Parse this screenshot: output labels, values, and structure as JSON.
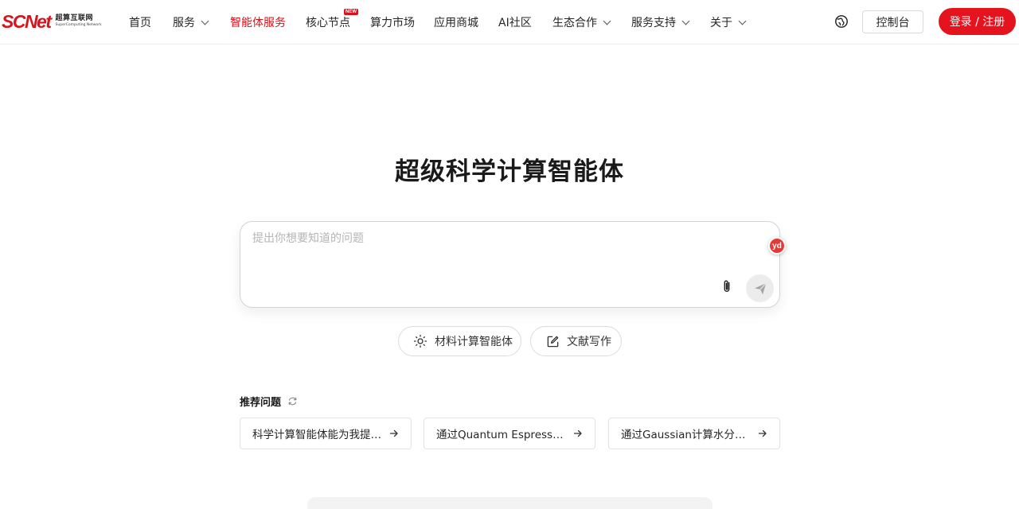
{
  "brand": {
    "logo_text": "SCNet",
    "logo_cn": "超算互联网",
    "logo_en": "SuperComputing Network",
    "accent_color": "#d9121b"
  },
  "nav": {
    "items": [
      {
        "label": "首页",
        "dropdown": false,
        "active": false
      },
      {
        "label": "服务",
        "dropdown": true,
        "active": false
      },
      {
        "label": "智能体服务",
        "dropdown": false,
        "active": true
      },
      {
        "label": "核心节点",
        "dropdown": false,
        "active": false,
        "badge": "NEW"
      },
      {
        "label": "算力市场",
        "dropdown": false,
        "active": false
      },
      {
        "label": "应用商城",
        "dropdown": false,
        "active": false
      },
      {
        "label": "AI社区",
        "dropdown": false,
        "active": false
      },
      {
        "label": "生态合作",
        "dropdown": true,
        "active": false
      },
      {
        "label": "服务支持",
        "dropdown": true,
        "active": false
      },
      {
        "label": "关于",
        "dropdown": true,
        "active": false
      }
    ],
    "language_icon": "globe-icon",
    "console_label": "控制台",
    "login_label": "登录 / 注册"
  },
  "main": {
    "title": "超级科学计算智能体",
    "input_placeholder": "提出你想要知道的问题",
    "assistant_badge": "yd",
    "chips": [
      {
        "label": "材料计算智能体",
        "icon": "sun-icon"
      },
      {
        "label": "文献写作",
        "icon": "edit-icon"
      }
    ],
    "recommended_title": "推荐问题",
    "recommended": [
      "科学计算智能体能为我提供什么帮助？",
      "通过Quantum Espresso做能带计算",
      "通过Gaussian计算水分子结构"
    ]
  }
}
